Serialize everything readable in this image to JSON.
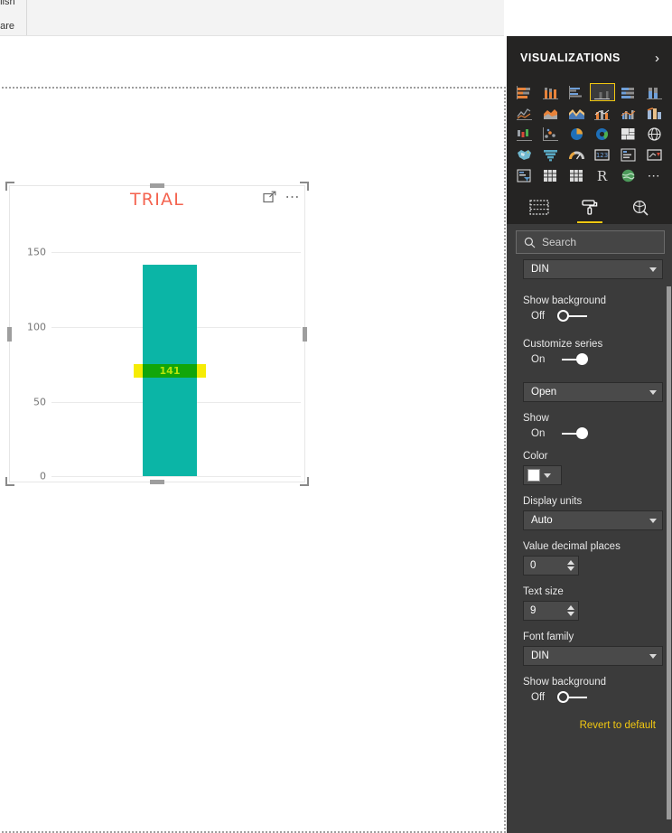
{
  "ribbon": {
    "label_top": "blish",
    "label_bottom": "hare"
  },
  "visual": {
    "title": "TRIAL",
    "focus_icon": "focus-mode-icon",
    "more_icon": "more-options-ellipsis",
    "chart_data": {
      "type": "bar",
      "title": "TRIAL",
      "categories": [
        ""
      ],
      "values": [
        141
      ],
      "data_labels": [
        "141"
      ],
      "ylabel": "",
      "xlabel": "",
      "ylim": [
        0,
        162
      ],
      "yticks": [
        150,
        100,
        50,
        0
      ],
      "ytick_labels": [
        "150",
        "100",
        "50",
        "0"
      ],
      "grid": true,
      "legend": "none",
      "bar_color": "#0bb5a6",
      "title_color": "#f4634f",
      "label_background_color": "#f6ec05",
      "label_text_color": "#b6e40a"
    }
  },
  "visualizations_pane": {
    "title": "VISUALIZATIONS",
    "collapse_icon": "chevron-right-icon",
    "icons": [
      {
        "name": "stacked-bar-chart-icon",
        "selected": false
      },
      {
        "name": "stacked-column-chart-icon",
        "selected": false
      },
      {
        "name": "clustered-bar-chart-icon",
        "selected": false
      },
      {
        "name": "clustered-column-chart-icon",
        "selected": true
      },
      {
        "name": "hundred-percent-stacked-bar-chart-icon",
        "selected": false
      },
      {
        "name": "hundred-percent-stacked-column-chart-icon",
        "selected": false
      },
      {
        "name": "line-chart-icon",
        "selected": false
      },
      {
        "name": "area-chart-icon",
        "selected": false
      },
      {
        "name": "stacked-area-chart-icon",
        "selected": false
      },
      {
        "name": "line-and-stacked-column-chart-icon",
        "selected": false
      },
      {
        "name": "line-and-clustered-column-chart-icon",
        "selected": false
      },
      {
        "name": "ribbon-chart-icon",
        "selected": false
      },
      {
        "name": "waterfall-chart-icon",
        "selected": false
      },
      {
        "name": "scatter-chart-icon",
        "selected": false
      },
      {
        "name": "pie-chart-icon",
        "selected": false
      },
      {
        "name": "donut-chart-icon",
        "selected": false
      },
      {
        "name": "treemap-icon",
        "selected": false
      },
      {
        "name": "map-icon",
        "selected": false
      },
      {
        "name": "filled-map-icon",
        "selected": false
      },
      {
        "name": "funnel-chart-icon",
        "selected": false
      },
      {
        "name": "gauge-chart-icon",
        "selected": false
      },
      {
        "name": "card-icon",
        "selected": false
      },
      {
        "name": "multi-row-card-icon",
        "selected": false
      },
      {
        "name": "kpi-icon",
        "selected": false
      },
      {
        "name": "slicer-icon",
        "selected": false
      },
      {
        "name": "table-icon",
        "selected": false
      },
      {
        "name": "matrix-icon",
        "selected": false
      },
      {
        "name": "r-script-visual-icon",
        "selected": false
      },
      {
        "name": "arcgis-maps-icon",
        "selected": false
      },
      {
        "name": "more-visuals-icon",
        "selected": false
      }
    ],
    "tabs": [
      {
        "name": "fields-tab",
        "icon": "fields-grid-icon",
        "active": false
      },
      {
        "name": "format-tab",
        "icon": "paint-roller-icon",
        "active": true
      },
      {
        "name": "analytics-tab",
        "icon": "analytics-magnifier-icon",
        "active": false
      }
    ],
    "search": {
      "placeholder": "Search",
      "value": "",
      "icon": "search-icon"
    }
  },
  "format_pane": {
    "controls": [
      {
        "type": "dropdown",
        "label": "",
        "value": "DIN",
        "name": "font-family-dropdown-top"
      },
      {
        "type": "toggle",
        "label": "Show background",
        "state": "Off",
        "name": "show-background-toggle-top"
      },
      {
        "type": "toggle",
        "label": "Customize series",
        "state": "On",
        "name": "customize-series-toggle"
      },
      {
        "type": "dropdown",
        "label": "",
        "value": "Open",
        "name": "series-dropdown"
      },
      {
        "type": "toggle",
        "label": "Show",
        "state": "On",
        "name": "show-toggle"
      },
      {
        "type": "color",
        "label": "Color",
        "value": "#ffffff",
        "name": "color-picker"
      },
      {
        "type": "dropdown",
        "label": "Display units",
        "value": "Auto",
        "name": "display-units-dropdown"
      },
      {
        "type": "spinner",
        "label": "Value decimal places",
        "value": "0",
        "name": "value-decimal-places-spinner"
      },
      {
        "type": "spinner",
        "label": "Text size",
        "value": "9",
        "name": "text-size-spinner"
      },
      {
        "type": "dropdown",
        "label": "Font family",
        "value": "DIN",
        "name": "font-family-dropdown"
      },
      {
        "type": "toggle",
        "label": "Show background",
        "state": "Off",
        "name": "show-background-toggle"
      }
    ],
    "labels": {
      "show_background_top": "Show background",
      "customize_series": "Customize series",
      "show": "Show",
      "color": "Color",
      "display_units": "Display units",
      "value_decimal_places": "Value decimal places",
      "text_size": "Text size",
      "font_family": "Font family",
      "show_background": "Show background"
    },
    "values": {
      "font_family_top": "DIN",
      "show_background_top_state": "Off",
      "customize_series_state": "On",
      "series": "Open",
      "show_state": "On",
      "display_units": "Auto",
      "value_decimal_places": "0",
      "text_size": "9",
      "font_family": "DIN",
      "show_background_state": "Off"
    },
    "revert_label": "Revert to default"
  }
}
